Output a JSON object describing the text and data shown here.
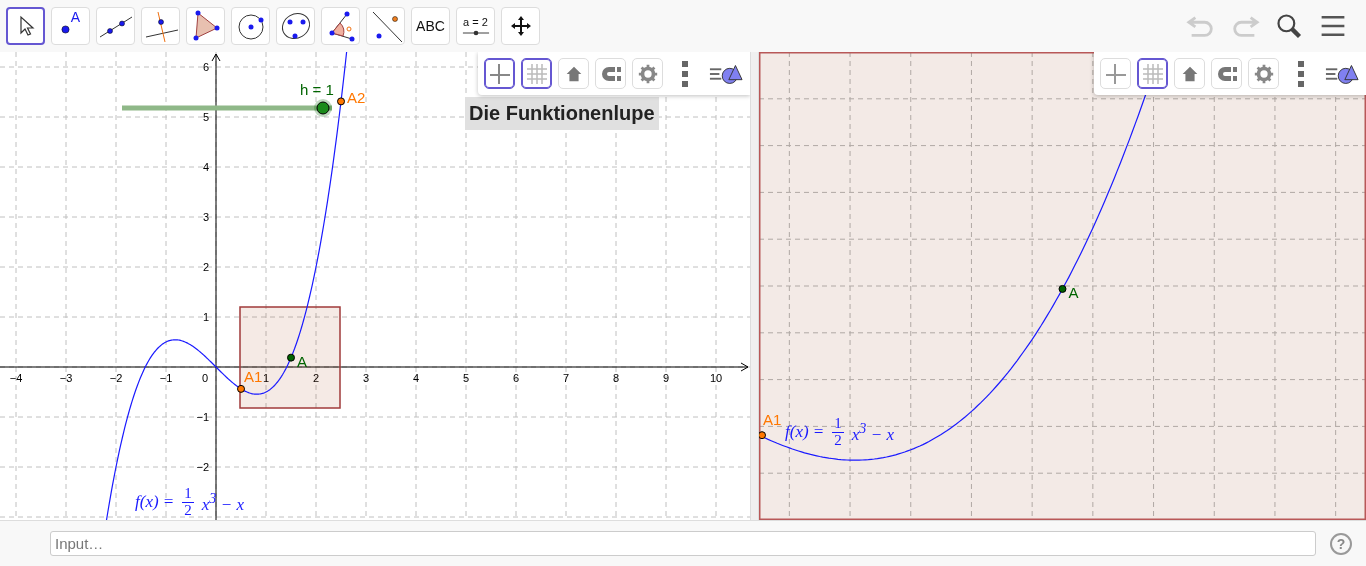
{
  "toolbar": {
    "tools": [
      {
        "kind": "move",
        "selected": true
      },
      {
        "kind": "point",
        "selected": false,
        "label": "A"
      },
      {
        "kind": "line",
        "selected": false
      },
      {
        "kind": "perpendicular",
        "selected": false
      },
      {
        "kind": "polygon",
        "selected": false
      },
      {
        "kind": "circle",
        "selected": false
      },
      {
        "kind": "conic",
        "selected": false
      },
      {
        "kind": "angle",
        "selected": false
      },
      {
        "kind": "reflect",
        "selected": false
      },
      {
        "kind": "text",
        "selected": false,
        "label": "ABC"
      },
      {
        "kind": "slider",
        "selected": false,
        "label": "a = 2"
      },
      {
        "kind": "pan",
        "selected": false
      }
    ],
    "actions": [
      {
        "kind": "undo",
        "disabled": true
      },
      {
        "kind": "redo",
        "disabled": true
      },
      {
        "kind": "search",
        "disabled": false
      },
      {
        "kind": "menu",
        "disabled": false
      }
    ]
  },
  "graphics": {
    "style_bar": [
      {
        "kind": "axes",
        "on": true
      },
      {
        "kind": "grid",
        "on": true
      },
      {
        "kind": "home",
        "on": false
      },
      {
        "kind": "magnet",
        "on": false
      },
      {
        "kind": "settings",
        "on": false
      },
      {
        "kind": "more"
      },
      {
        "kind": "view"
      }
    ],
    "x_tick_labels": [
      "−4",
      "−3",
      "−2",
      "−1",
      "1",
      "2",
      "3",
      "4",
      "5",
      "6",
      "7",
      "8",
      "9",
      "10"
    ],
    "y_tick_labels": [
      "6",
      "5",
      "4",
      "3",
      "2",
      "1",
      "−1",
      "−2"
    ],
    "origin_label": "0",
    "title_label": "Die Funktionenlupe",
    "slider": {
      "label": "h = 1",
      "level": 1
    },
    "points": [
      {
        "label": "A2",
        "color": "#ff7700"
      },
      {
        "label": "A",
        "color": "#006400"
      },
      {
        "label": "A1",
        "color": "#ff7700"
      }
    ],
    "formula": {
      "lhs": "f(x) =",
      "numerator": "1",
      "denominator": "2",
      "rest": "x$^{3}$ − x"
    }
  },
  "graphics2": {
    "style_bar": [
      {
        "kind": "axes",
        "on": false
      },
      {
        "kind": "grid",
        "on": true
      },
      {
        "kind": "home",
        "on": false
      },
      {
        "kind": "magnet",
        "on": false
      },
      {
        "kind": "settings",
        "on": false
      },
      {
        "kind": "more"
      },
      {
        "kind": "view"
      }
    ],
    "points": [
      {
        "label": "A",
        "color": "#006400"
      },
      {
        "label": "A1",
        "color": "#ff7700"
      }
    ],
    "formula": {
      "lhs": "f(x) =",
      "numerator": "1",
      "denominator": "2",
      "rest": "x$^{3}$ − x"
    }
  },
  "input_bar": {
    "placeholder": "Input…",
    "help": "?"
  }
}
